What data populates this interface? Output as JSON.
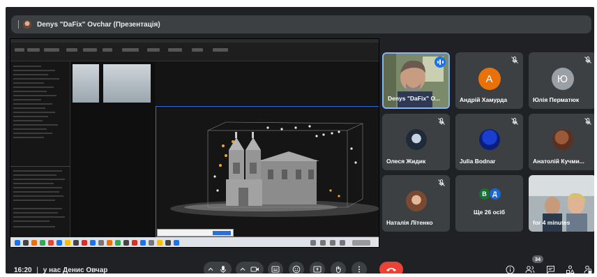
{
  "presenter_bar": {
    "title": "Denys \"DaFix\" Ovchar (Презентація)"
  },
  "participants": [
    {
      "name": "Denys \"DaFix\" O...",
      "type": "video",
      "speaking": true
    },
    {
      "name": "Андрій Хамурда",
      "initial": "А",
      "avatar_color": "#e8710a",
      "muted": true
    },
    {
      "name": "Юлія Перматюк",
      "initial": "Ю",
      "avatar_color": "#9aa0a6",
      "muted": true
    },
    {
      "name": "Олеся Жидик",
      "type": "photo",
      "muted": true
    },
    {
      "name": "Julia Bodnar",
      "type": "photo",
      "muted": true
    },
    {
      "name": "Анатолій Кучми...",
      "type": "photo",
      "muted": true
    },
    {
      "name": "Наталія Літенко",
      "type": "photo",
      "muted": true
    },
    {
      "name": "Ще 26 осіб",
      "type": "group",
      "initials": [
        "В",
        "Д"
      ]
    },
    {
      "name": "for 4 minutes",
      "type": "video"
    }
  ],
  "bottom_bar": {
    "time": "16:20",
    "separator": "|",
    "meeting_name": "у нас Денис Овчар",
    "participant_count": "34"
  },
  "colors": {
    "background": "#202124",
    "tile": "#3c4043",
    "end_call": "#ea4335",
    "accent": "#1a73e8"
  }
}
